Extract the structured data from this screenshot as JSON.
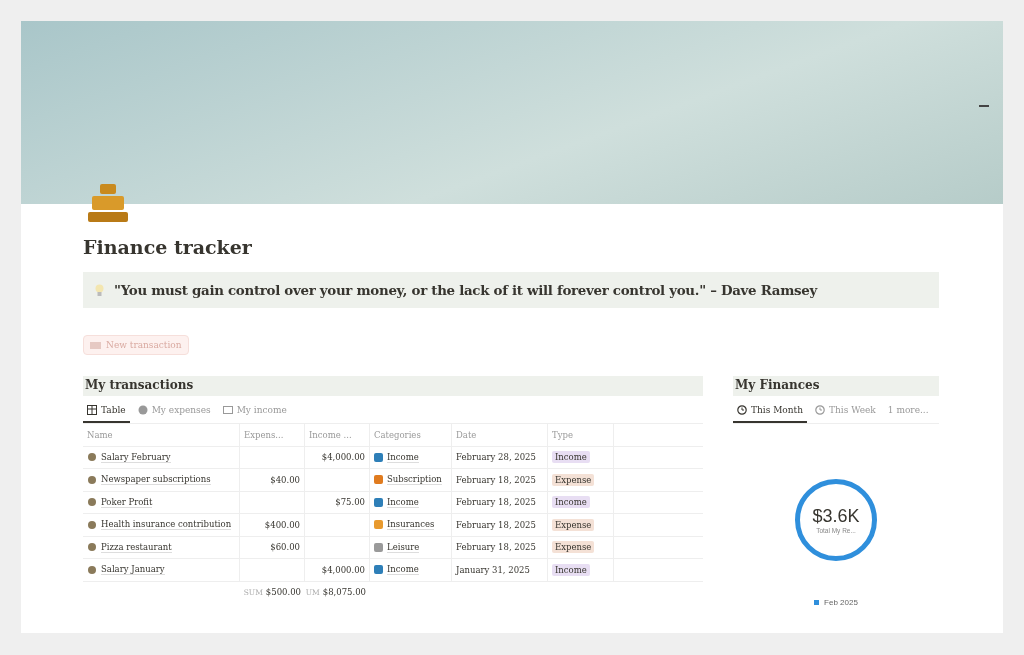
{
  "page": {
    "title": "Finance tracker",
    "quote": "\"You must gain control over your money, or the lack of it will forever control you.\" – Dave Ramsey",
    "new_button": "New transaction"
  },
  "transactions": {
    "heading": "My transactions",
    "tabs": [
      {
        "label": "Table",
        "selected": true
      },
      {
        "label": "My expenses",
        "selected": false
      },
      {
        "label": "My income",
        "selected": false
      }
    ],
    "columns": [
      "Name",
      "Expens...",
      "Income ...",
      "Categories",
      "Date",
      "Type"
    ],
    "rows": [
      {
        "name": "Salary February",
        "expense": "",
        "income": "$4,000.00",
        "category": {
          "label": "Income",
          "color": "#2e7fb8"
        },
        "date": "February 28, 2025",
        "type": {
          "label": "Income",
          "color": "#e8def3"
        }
      },
      {
        "name": "Newspaper subscriptions",
        "expense": "$40.00",
        "income": "",
        "category": {
          "label": "Subscription",
          "color": "#e07b1f"
        },
        "date": "February 18, 2025",
        "type": {
          "label": "Expense",
          "color": "#f4e1d6"
        }
      },
      {
        "name": "Poker Profit",
        "expense": "",
        "income": "$75.00",
        "category": {
          "label": "Income",
          "color": "#2e7fb8"
        },
        "date": "February 18, 2025",
        "type": {
          "label": "Income",
          "color": "#e8def3"
        }
      },
      {
        "name": "Health insurance contribution",
        "expense": "$400.00",
        "income": "",
        "category": {
          "label": "Insurances",
          "color": "#e89a2e"
        },
        "date": "February 18, 2025",
        "type": {
          "label": "Expense",
          "color": "#f4e1d6"
        }
      },
      {
        "name": "Pizza restaurant",
        "expense": "$60.00",
        "income": "",
        "category": {
          "label": "Leisure",
          "color": "#9a9a9a"
        },
        "date": "February 18, 2025",
        "type": {
          "label": "Expense",
          "color": "#f4e1d6"
        }
      },
      {
        "name": "Salary January",
        "expense": "",
        "income": "$4,000.00",
        "category": {
          "label": "Income",
          "color": "#2e7fb8"
        },
        "date": "January 31, 2025",
        "type": {
          "label": "Income",
          "color": "#e8def3"
        }
      }
    ],
    "sums": [
      {
        "label": "SUM",
        "value": "$500.00"
      },
      {
        "label": "UM",
        "value": "$8,075.00"
      }
    ]
  },
  "finances": {
    "heading": "My Finances",
    "tabs": [
      {
        "label": "This Month",
        "selected": true
      },
      {
        "label": "This Week",
        "selected": false
      }
    ],
    "more": "1 more...",
    "total": "$3.6K",
    "total_label": "Total My Re...",
    "legend": [
      {
        "label": "Feb 2025",
        "color": "#2f8fdc"
      }
    ]
  }
}
